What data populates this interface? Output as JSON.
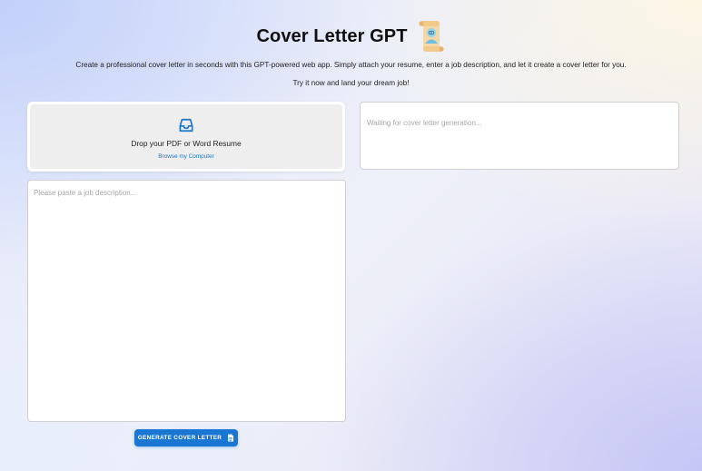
{
  "app": {
    "title": "Cover Letter GPT",
    "logo_icon": "scroll-robot-icon",
    "description": "Create a professional cover letter in seconds with this GPT-powered web app. Simply attach your resume, enter a job description, and let it create a cover letter for you.",
    "tagline": "Try it now and land your dream job!"
  },
  "upload": {
    "icon": "inbox-icon",
    "label": "Drop your PDF or Word Resume",
    "browse_label": "Browse my Computer"
  },
  "output": {
    "placeholder": "Waiting for cover letter generation..."
  },
  "job": {
    "placeholder": "Please paste a job description...",
    "value": ""
  },
  "generate": {
    "label": "GENERATE COVER LETTER",
    "icon": "document-icon"
  },
  "colors": {
    "accent": "#1976d2",
    "upload_bg": "#eeeeee",
    "placeholder": "#a6a6a6"
  }
}
